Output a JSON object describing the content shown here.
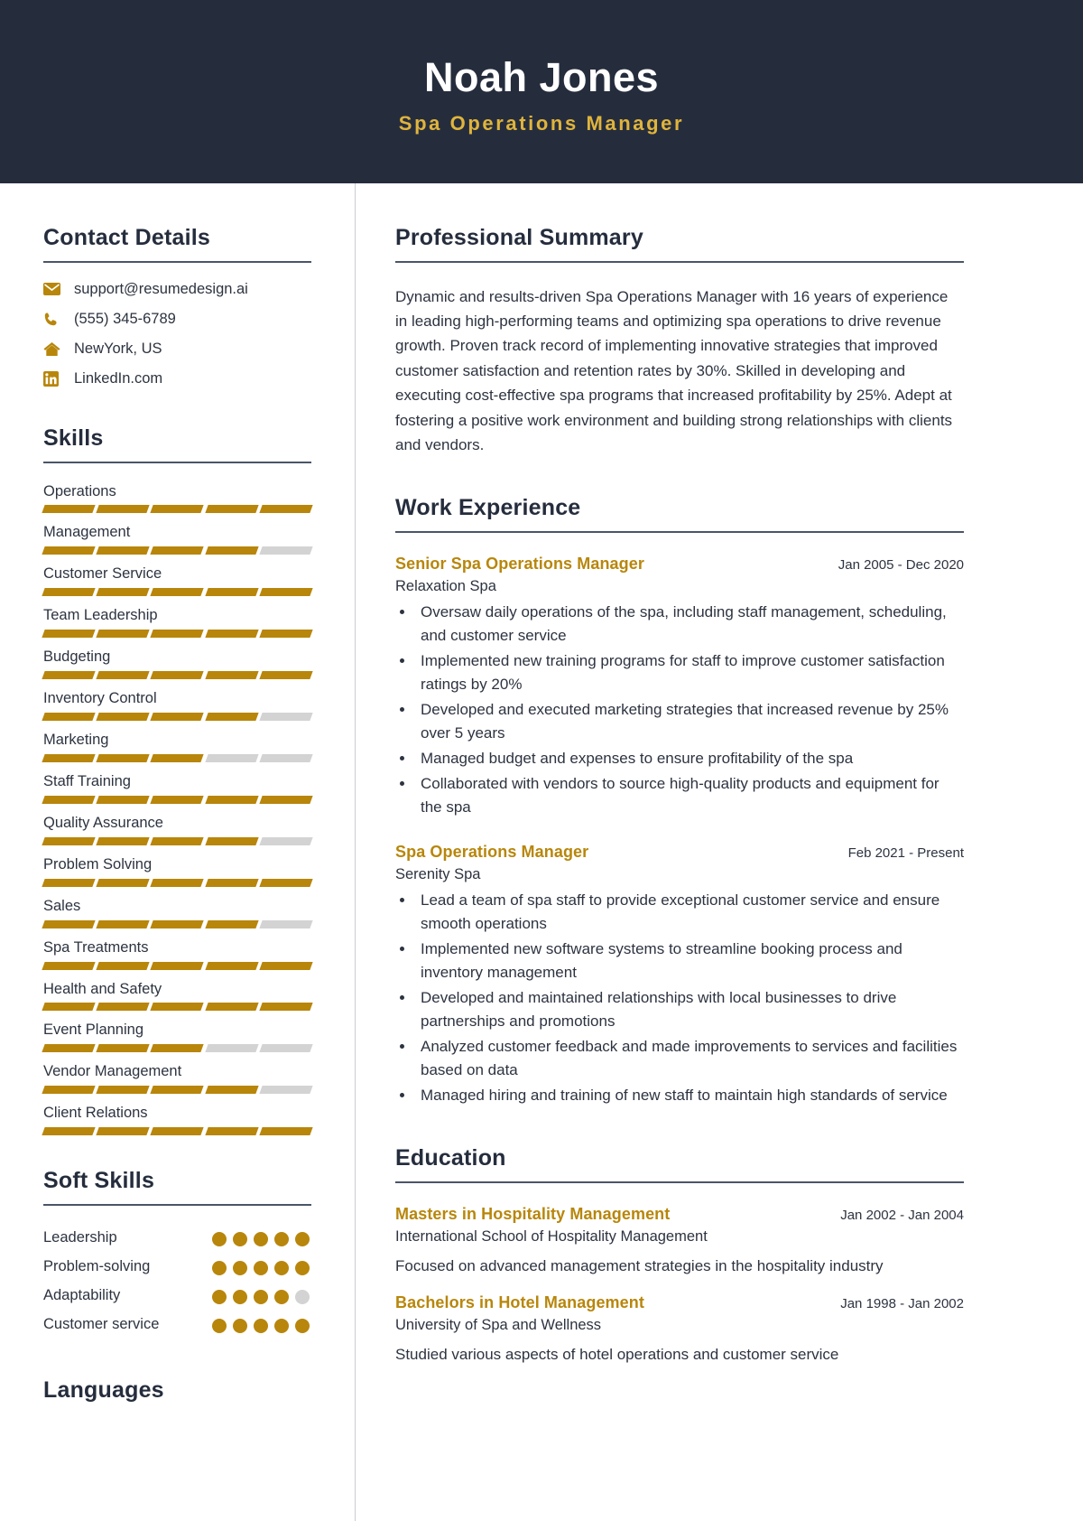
{
  "header": {
    "name": "Noah Jones",
    "role": "Spa Operations Manager",
    "bg_color": "#252d3d",
    "accent_color": "#b8860b",
    "role_color": "#e0b43c"
  },
  "sidebar": {
    "contact": {
      "title": "Contact Details",
      "items": [
        {
          "icon": "email-icon",
          "value": "support@resumedesign.ai"
        },
        {
          "icon": "phone-icon",
          "value": "(555) 345-6789"
        },
        {
          "icon": "home-icon",
          "value": "NewYork, US"
        },
        {
          "icon": "linkedin-icon",
          "value": "LinkedIn.com"
        }
      ]
    },
    "skills": {
      "title": "Skills",
      "max_level": 5,
      "items": [
        {
          "label": "Operations",
          "level": 5
        },
        {
          "label": "Management",
          "level": 4
        },
        {
          "label": "Customer Service",
          "level": 5
        },
        {
          "label": "Team Leadership",
          "level": 5
        },
        {
          "label": "Budgeting",
          "level": 5
        },
        {
          "label": "Inventory Control",
          "level": 4
        },
        {
          "label": "Marketing",
          "level": 3
        },
        {
          "label": "Staff Training",
          "level": 5
        },
        {
          "label": "Quality Assurance",
          "level": 4
        },
        {
          "label": "Problem Solving",
          "level": 5
        },
        {
          "label": "Sales",
          "level": 4
        },
        {
          "label": "Spa Treatments",
          "level": 5
        },
        {
          "label": "Health and Safety",
          "level": 5
        },
        {
          "label": "Event Planning",
          "level": 3
        },
        {
          "label": "Vendor Management",
          "level": 4
        },
        {
          "label": "Client Relations",
          "level": 5
        }
      ]
    },
    "soft_skills": {
      "title": "Soft Skills",
      "max_level": 5,
      "items": [
        {
          "label": "Leadership",
          "level": 5
        },
        {
          "label": "Problem-solving",
          "level": 5
        },
        {
          "label": "Adaptability",
          "level": 4
        },
        {
          "label": "Customer service",
          "level": 5
        }
      ]
    },
    "languages": {
      "title": "Languages"
    }
  },
  "main": {
    "summary": {
      "title": "Professional Summary",
      "text": "Dynamic and results-driven Spa Operations Manager with 16 years of experience in leading high-performing teams and optimizing spa operations to drive revenue growth. Proven track record of implementing innovative strategies that improved customer satisfaction and retention rates by 30%. Skilled in developing and executing cost-effective spa programs that increased profitability by 25%. Adept at fostering a positive work environment and building strong relationships with clients and vendors."
    },
    "work": {
      "title": "Work Experience",
      "entries": [
        {
          "title": "Senior Spa Operations Manager",
          "date": "Jan 2005 - Dec 2020",
          "org": "Relaxation Spa",
          "bullets": [
            "Oversaw daily operations of the spa, including staff management, scheduling, and customer service",
            "Implemented new training programs for staff to improve customer satisfaction ratings by 20%",
            "Developed and executed marketing strategies that increased revenue by 25% over 5 years",
            "Managed budget and expenses to ensure profitability of the spa",
            "Collaborated with vendors to source high-quality products and equipment for the spa"
          ]
        },
        {
          "title": "Spa Operations Manager",
          "date": "Feb 2021 - Present",
          "org": "Serenity Spa",
          "bullets": [
            "Lead a team of spa staff to provide exceptional customer service and ensure smooth operations",
            "Implemented new software systems to streamline booking process and inventory management",
            "Developed and maintained relationships with local businesses to drive partnerships and promotions",
            "Analyzed customer feedback and made improvements to services and facilities based on data",
            "Managed hiring and training of new staff to maintain high standards of service"
          ]
        }
      ]
    },
    "education": {
      "title": "Education",
      "entries": [
        {
          "title": "Masters in Hospitality Management",
          "date": "Jan 2002 - Jan 2004",
          "org": "International School of Hospitality Management",
          "desc": "Focused on advanced management strategies in the hospitality industry"
        },
        {
          "title": "Bachelors in Hotel Management",
          "date": "Jan 1998 - Jan 2002",
          "org": "University of Spa and Wellness",
          "desc": "Studied various aspects of hotel operations and customer service"
        }
      ]
    }
  }
}
